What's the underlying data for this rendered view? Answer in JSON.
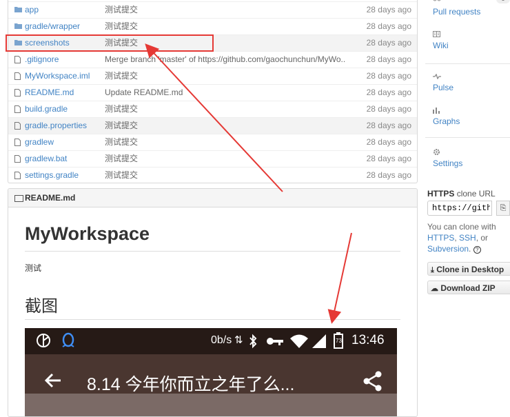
{
  "files": [
    {
      "name": "app",
      "message": "测试提交",
      "age": "28 days ago",
      "type": "folder"
    },
    {
      "name": "gradle/wrapper",
      "message": "测试提交",
      "age": "28 days ago",
      "type": "folder"
    },
    {
      "name": "screenshots",
      "message": "测试提交",
      "age": "28 days ago",
      "type": "folder"
    },
    {
      "name": ".gitignore",
      "message": "Merge branch 'master' of https://github.com/gaochunchun/MyWo...",
      "age": "28 days ago",
      "type": "file"
    },
    {
      "name": "MyWorkspace.iml",
      "message": "测试提交",
      "age": "28 days ago",
      "type": "file"
    },
    {
      "name": "README.md",
      "message": "Update README.md",
      "age": "28 days ago",
      "type": "file"
    },
    {
      "name": "build.gradle",
      "message": "测试提交",
      "age": "28 days ago",
      "type": "file"
    },
    {
      "name": "gradle.properties",
      "message": "测试提交",
      "age": "28 days ago",
      "type": "file"
    },
    {
      "name": "gradlew",
      "message": "测试提交",
      "age": "28 days ago",
      "type": "file"
    },
    {
      "name": "gradlew.bat",
      "message": "测试提交",
      "age": "28 days ago",
      "type": "file"
    },
    {
      "name": "settings.gradle",
      "message": "测试提交",
      "age": "28 days ago",
      "type": "file"
    }
  ],
  "readme": {
    "header": "README.md",
    "title": "MyWorkspace",
    "paragraph": "测试",
    "section_title": "截图",
    "phone": {
      "speed": "0b/s",
      "battery": "73",
      "time": "13:46",
      "app_title": "8.14 今年你而立之年了么..."
    }
  },
  "sidebar": {
    "pr_count": "0",
    "nav": [
      "Pull requests",
      "Wiki",
      "Pulse",
      "Graphs",
      "Settings"
    ],
    "clone": {
      "label_bold": "HTTPS",
      "label_rest": "clone URL",
      "url": "https://gith",
      "help_prefix": "You can clone with",
      "link_https": "HTTPS",
      "link_ssh": "SSH",
      "or": ", or",
      "link_subversion": "Subversion",
      "period": ".",
      "help_icon": "?"
    },
    "clone_desktop": "Clone in Desktop",
    "download_zip": "Download ZIP"
  },
  "colors": {
    "link": "#4183c4",
    "highlight": "#e53935"
  }
}
